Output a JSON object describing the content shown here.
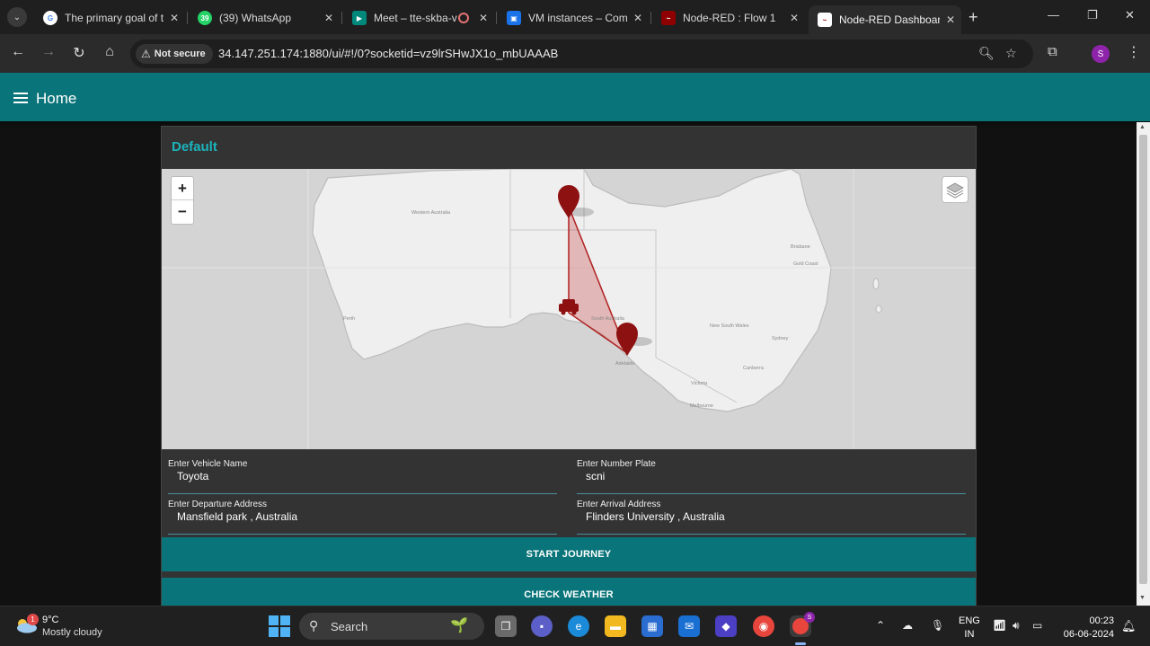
{
  "browser": {
    "tabs": [
      {
        "title": "The primary goal of t",
        "favicon_color": "#4285f4",
        "active": false
      },
      {
        "title": "(39) WhatsApp",
        "favicon_color": "#25d366",
        "active": false
      },
      {
        "title": "Meet – tte-skba-v",
        "favicon_color": "#00897b",
        "active": false
      },
      {
        "title": "VM instances – Comp",
        "favicon_color": "#4285f4",
        "active": false
      },
      {
        "title": "Node-RED : Flow 1",
        "favicon_color": "#8f0000",
        "active": false
      },
      {
        "title": "Node-RED Dashboard",
        "favicon_color": "#8f0000",
        "active": true
      }
    ],
    "whatsapp_badge": "39",
    "security_label": "Not secure",
    "url": "34.147.251.174:1880/ui/#!/0?socketid=vz9lrSHwJX1o_mbUAAAB",
    "profile_initial": "S"
  },
  "app": {
    "title": "Home",
    "group_title": "Default",
    "accent": "#097479",
    "map": {
      "zoom_in": "+",
      "zoom_out": "−",
      "labels": {
        "western_australia": "Western Australia",
        "perth": "Perth",
        "south_australia": "South Australia",
        "adelaide": "Adelaide",
        "new_south_wales": "New South Wales",
        "brisbane": "Brisbane",
        "gold_coast": "Gold Coast",
        "sydney": "Sydney",
        "canberra": "Canberra",
        "victoria": "Victoria",
        "melbourne": "Melbourne"
      }
    },
    "form": {
      "vehicle_name": {
        "label": "Enter Vehicle Name",
        "value": "Toyota"
      },
      "number_plate": {
        "label": "Enter Number Plate",
        "value": "scni"
      },
      "departure": {
        "label": "Enter Departure Address",
        "value": "Mansfield park , Australia"
      },
      "arrival": {
        "label": "Enter Arrival Address",
        "value": "Flinders University , Australia"
      }
    },
    "buttons": {
      "start_journey": "START JOURNEY",
      "check_weather": "CHECK WEATHER"
    }
  },
  "taskbar": {
    "weather_badge": "1",
    "temperature": "9°C",
    "condition": "Mostly cloudy",
    "search_label": "Search",
    "lang_line1": "ENG",
    "lang_line2": "IN",
    "time": "00:23",
    "date": "06-06-2024",
    "chrome_badge": "S"
  }
}
